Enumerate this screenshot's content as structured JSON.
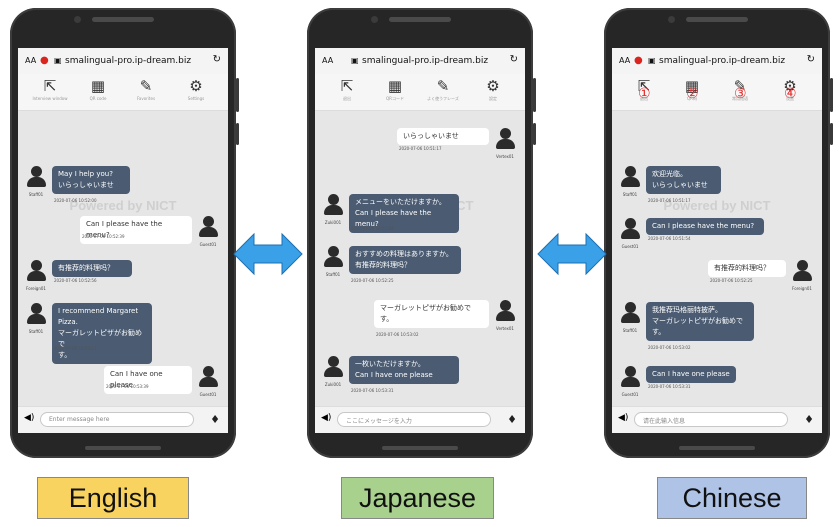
{
  "browser": {
    "aa": "AA",
    "url": "smalingual-pro.ip-dream.biz"
  },
  "icons": {
    "external": "external-link-icon",
    "qr": "qr-code-icon",
    "phrases": "edit-document-icon",
    "settings": "gear-icon",
    "speaker": "speaker-icon",
    "mic": "microphone-icon"
  },
  "watermark": "Powered by NICT",
  "circled_numbers": [
    "①",
    "②",
    "③",
    "④"
  ],
  "colors": {
    "bubble_dark": "#4a5b72",
    "circled_red": "#e53030",
    "arrow_blue": "#3aa0e8"
  },
  "phones": [
    {
      "toolbar_labels": [
        "Interview window",
        "QR code",
        "Favorites",
        "Settings"
      ],
      "placeholder": "Enter message here",
      "messages": [
        {
          "side": "left",
          "style": "dark",
          "lines": [
            "May I help you?",
            "いらっしゃいませ"
          ],
          "time": "2020-07-06 10:52:00",
          "user": "Staff01"
        },
        {
          "side": "right",
          "style": "light",
          "lines": [
            "Can I please have the menu?"
          ],
          "time": "2020-07-06 10:52:39",
          "user": "Guest01"
        },
        {
          "side": "left",
          "style": "dark",
          "lines": [
            "有推荐的料理吗？"
          ],
          "time": "2020-07-06 10:52:56",
          "user": "Foreign01"
        },
        {
          "side": "left",
          "style": "dark",
          "lines": [
            "I recommend Margaret Pizza.",
            "マーガレットピザがお勧めで",
            "す。"
          ],
          "time": "2020-07-06 10:53:11",
          "user": "Staff01"
        },
        {
          "side": "right",
          "style": "light",
          "lines": [
            "Can I have one please"
          ],
          "time": "2020-07-06 10:53:39",
          "user": "Guest01"
        }
      ]
    },
    {
      "toolbar_labels": [
        "退出",
        "QRコード",
        "よく使うフレーズ",
        "設定"
      ],
      "placeholder": "ここにメッセージを入力",
      "messages": [
        {
          "side": "right",
          "style": "light",
          "lines": [
            "いらっしゃいませ"
          ],
          "time": "2020-07-06 10:51:17",
          "user": "Vertex01"
        },
        {
          "side": "left",
          "style": "dark",
          "lines": [
            "メニューをいただけますか。",
            "Can I please have the menu?"
          ],
          "time": "2020-07-06 10:51:54",
          "user": "Zuki001"
        },
        {
          "side": "left",
          "style": "dark",
          "lines": [
            "おすすめの料理はありますか。",
            "有推荐的料理吗？"
          ],
          "time": "2020-07-06 10:52:25",
          "user": "Staff01"
        },
        {
          "side": "right",
          "style": "light",
          "lines": [
            "マーガレットピザがお勧めで",
            "す。"
          ],
          "time": "2020-07-06 10:53:02",
          "user": "Vertex01"
        },
        {
          "side": "left",
          "style": "dark",
          "lines": [
            "一枚いただけますか。",
            "Can I have one please"
          ],
          "time": "2020-07-06 10:53:31",
          "user": "Zuki001"
        }
      ]
    },
    {
      "toolbar_labels": [
        "退出",
        "QR码",
        "常用短语",
        "设置"
      ],
      "placeholder": "请在此输入信息",
      "messages": [
        {
          "side": "left",
          "style": "dark",
          "lines": [
            "欢迎光临。",
            "いらっしゃいませ"
          ],
          "time": "2020-07-06 10:51:17",
          "user": "Staff01"
        },
        {
          "side": "left",
          "style": "dark",
          "lines": [
            "Can I please have the menu?"
          ],
          "time": "2020-07-06 10:51:54",
          "user": "Guest01"
        },
        {
          "side": "right",
          "style": "light",
          "lines": [
            "有推荐的料理吗？"
          ],
          "time": "2020-07-06 10:52:25",
          "user": "Foreign01"
        },
        {
          "side": "left",
          "style": "dark",
          "lines": [
            "我推荐玛格丽特披萨。",
            "マーガレットピザがお勧めで",
            "す。"
          ],
          "time": "2020-07-06 10:53:02",
          "user": "Staff01"
        },
        {
          "side": "left",
          "style": "dark",
          "lines": [
            "Can I have one please"
          ],
          "time": "2020-07-06 10:53:31",
          "user": "Guest01"
        }
      ]
    }
  ],
  "languages": [
    {
      "label": "English",
      "bg": "#f9d360"
    },
    {
      "label": "Japanese",
      "bg": "#a9d18e"
    },
    {
      "label": "Chinese",
      "bg": "#aec3e6"
    }
  ]
}
